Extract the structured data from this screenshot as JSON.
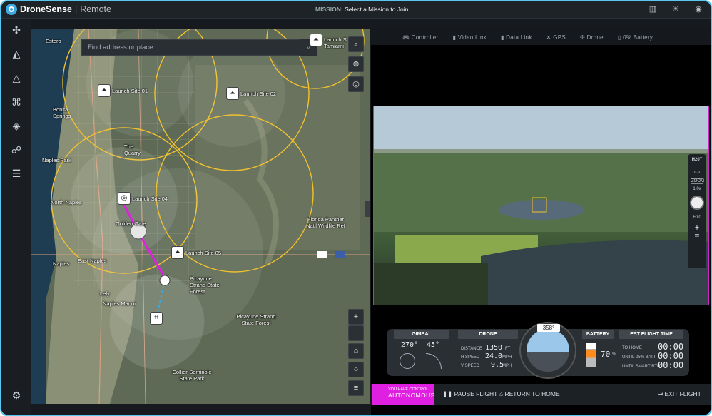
{
  "app": {
    "brand": "DroneSense",
    "separator": "|",
    "section": "Remote"
  },
  "mission": {
    "label": "MISSION:",
    "text": "Select a Mission to Join"
  },
  "top_icons": [
    "chart-icon",
    "weather-icon",
    "user-icon"
  ],
  "sidebar": {
    "items": [
      "drone-icon",
      "mission-icon",
      "alert-icon",
      "controller-icon",
      "tag-icon",
      "users-icon",
      "clipboard-icon"
    ],
    "settings": "gear-icon"
  },
  "map": {
    "search_placeholder": "Find address or place...",
    "labels": [
      {
        "text": "Launch Site 01"
      },
      {
        "text": "Launch Site 02"
      },
      {
        "text": "Launch Site 04"
      },
      {
        "text": "Launch Site 05"
      },
      {
        "text": "Bonita Springs"
      },
      {
        "text": "The Quarry"
      },
      {
        "text": "Naples Park"
      },
      {
        "text": "North Naples"
      },
      {
        "text": "Golden Gate"
      },
      {
        "text": "East Naples"
      },
      {
        "text": "Naples"
      },
      {
        "text": "Lely"
      },
      {
        "text": "Naples Manor"
      },
      {
        "text": "Picayune Strand State Forest"
      },
      {
        "text": "Picayune Strand State Forest"
      },
      {
        "text": "Florida Panther Nat'l Wildlife Ref"
      },
      {
        "text": "Collier-Seminole State Park"
      },
      {
        "text": "Estero"
      },
      {
        "text": "Launch S Tamiami"
      }
    ],
    "controls": [
      "zoom-in",
      "zoom-out",
      "lock",
      "locate",
      "layers"
    ]
  },
  "status": {
    "controller": "Controller",
    "video": "Video Link",
    "data": "Data Link",
    "gps": "GPS",
    "drone": "Drone",
    "battery": "0% Battery"
  },
  "camera": {
    "model": "H20T",
    "zoom": "ZOOM",
    "zoom_val": "1.0x",
    "ev": "±0.0"
  },
  "telemetry": {
    "gimbal": {
      "header": "GIMBAL",
      "yaw": "270°",
      "pitch": "45°"
    },
    "drone": {
      "header": "DRONE",
      "distance_label": "DISTANCE",
      "distance": "1350",
      "distance_unit": "FT",
      "hspeed_label": "H SPEED",
      "hspeed": "24.0",
      "hspeed_unit": "MPH",
      "vspeed_label": "V SPEED",
      "vspeed": "9.5",
      "vspeed_unit": "MPH"
    },
    "heading": "358°",
    "battery": {
      "header": "BATTERY",
      "value": "70",
      "unit": "%"
    },
    "flight_time": {
      "header": "EST FLIGHT TIME",
      "to_home_label": "TO HOME",
      "to_home": "00:00",
      "until25_label": "UNTIL 25% BATT",
      "until25": "00:00",
      "until_rth_label": "UNTIL SMART RTH",
      "until_rth": "00:00"
    }
  },
  "controls": {
    "you_have_control": "YOU HAVE CONTROL",
    "mode": "AUTONOMOUS",
    "pause": "PAUSE FLIGHT",
    "rth": "RETURN TO HOME",
    "exit": "EXIT FLIGHT"
  },
  "colors": {
    "accent": "#e020e0",
    "border": "#58c7f0",
    "circle": "#f2c12e",
    "path": "#e020e0",
    "path2": "#3da9e0"
  }
}
